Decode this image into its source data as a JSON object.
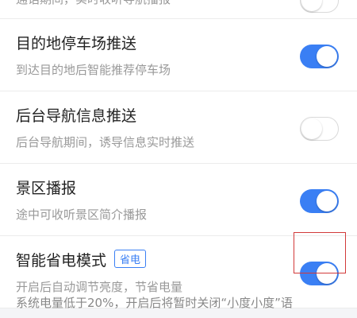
{
  "settings": [
    {
      "title": "",
      "subtitle": "通话期间，实时收听导航播报",
      "enabled": false
    },
    {
      "title": "目的地停车场推送",
      "subtitle": "到达目的地后智能推荐停车场",
      "enabled": true
    },
    {
      "title": "后台导航信息推送",
      "subtitle": "后台导航期间，诱导信息实时推送",
      "enabled": false
    },
    {
      "title": "景区播报",
      "subtitle": "途中可收听景区简介播报",
      "enabled": true
    },
    {
      "title": "智能省电模式",
      "badge": "省电",
      "subtitle": "开启后自动调节亮度，节省电量",
      "enabled": true
    }
  ],
  "footer_note": "系统电量低于20%，开启后将暂时关闭“小度小度”语",
  "colors": {
    "accent": "#3a7ff4",
    "highlight_box": "#d23a3a"
  }
}
